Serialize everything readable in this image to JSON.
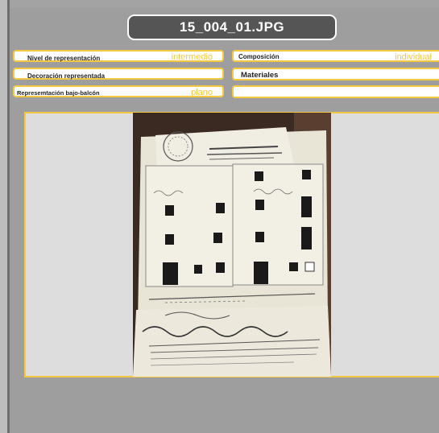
{
  "window": {
    "title": "15_004_01.JPG"
  },
  "fields": {
    "nivel": {
      "label": "Nivel de representación",
      "value": "intermedio"
    },
    "composicion": {
      "label": "Composición",
      "value": "individual"
    },
    "decoracion": {
      "label": "Decoración representada",
      "value": ""
    },
    "materiales": {
      "label": "Materiales",
      "value": ""
    },
    "bajo_balcon": {
      "label": "Represemtación bajo-balcón",
      "value": "plano"
    },
    "extra": {
      "label": "",
      "value": ""
    }
  },
  "image": {
    "description_icon": "architectural-plan-photo",
    "colors": {
      "accent": "#f5c842",
      "title_bg": "#555555",
      "panel_bg": "#dddddd"
    }
  }
}
